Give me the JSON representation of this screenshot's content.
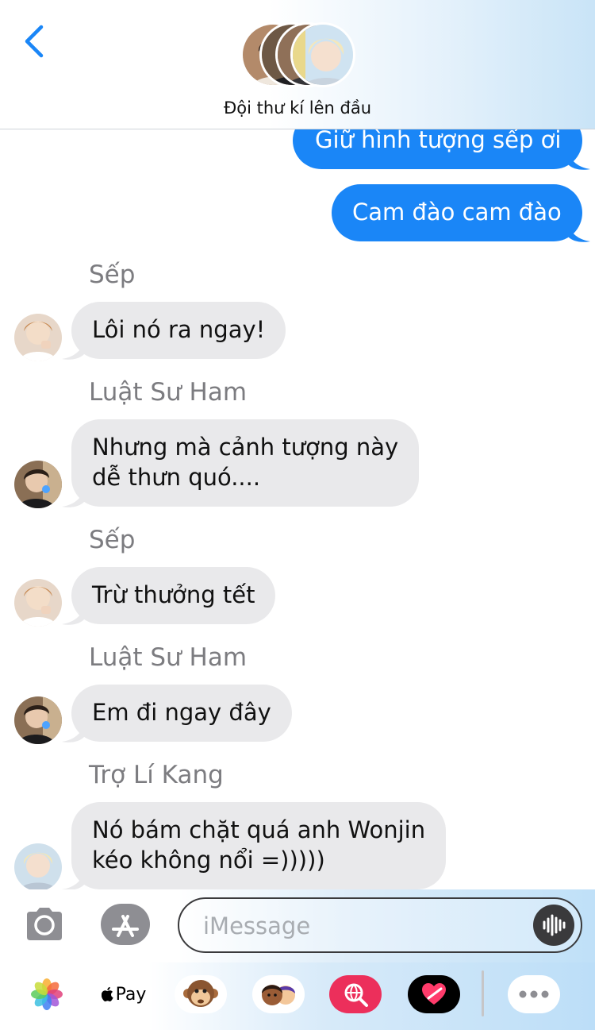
{
  "header": {
    "title": "Đội thư kí lên đầu"
  },
  "messages": {
    "out_1": "Giữ hình tượng sếp ơi",
    "out_2": "Cam đào cam đào",
    "sender_1": "Sếp",
    "in_1": "Lôi nó ra ngay!",
    "sender_2": "Luật Sư Ham",
    "in_2_line1": "Nhưng mà cảnh tượng này",
    "in_2_line2": "dễ thưn quó....",
    "sender_3": "Sếp",
    "in_3": "Trừ thưởng tết",
    "sender_4": "Luật Sư Ham",
    "in_4": "Em đi ngay đây",
    "sender_5": "Trợ Lí Kang",
    "in_5_line1": "Nó bám chặt quá anh Wonjin",
    "in_5_line2": "kéo không nổi =)))))"
  },
  "input": {
    "placeholder": "iMessage"
  },
  "apps": {
    "apple_pay": "Pay"
  },
  "colors": {
    "outgoing": "#1a86f7",
    "incoming": "#e9e9eb",
    "accent": "#1a86f7"
  },
  "icons": [
    "chevron-left-icon",
    "camera-icon",
    "app-store-icon",
    "waveform-icon",
    "photos-icon",
    "apple-icon",
    "monkey-animoji-icon",
    "memoji-icon",
    "web-search-icon",
    "digital-touch-icon",
    "more-icon"
  ]
}
